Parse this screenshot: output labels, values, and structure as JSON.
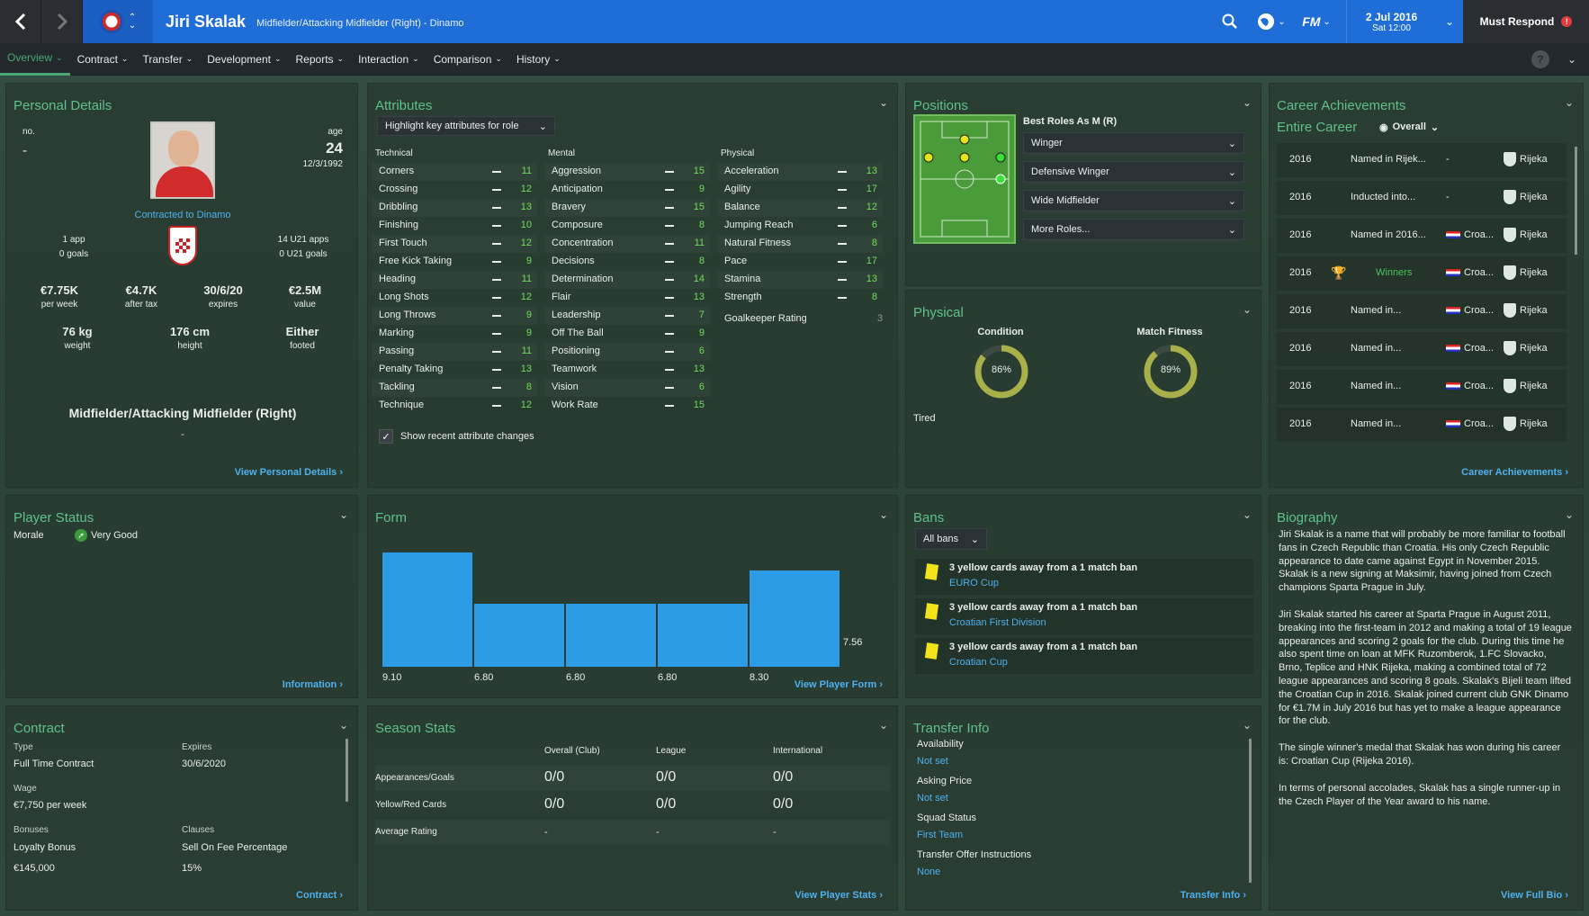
{
  "header": {
    "player_name": "Jiri Skalak",
    "player_subtitle": "Midfielder/Attacking Midfielder (Right) - Dinamo",
    "date": "2 Jul 2016",
    "time": "Sat 12:00",
    "must_respond": "Must Respond",
    "notif_count": "!",
    "fm_logo": "FM"
  },
  "tabs": [
    {
      "label": "Overview"
    },
    {
      "label": "Contract"
    },
    {
      "label": "Transfer"
    },
    {
      "label": "Development"
    },
    {
      "label": "Reports"
    },
    {
      "label": "Interaction"
    },
    {
      "label": "Comparison"
    },
    {
      "label": "History"
    }
  ],
  "help_label": "?",
  "personal": {
    "title": "Personal Details",
    "no_label": "no.",
    "no_value": "-",
    "age_label": "age",
    "age_value": "24",
    "dob": "12/3/1992",
    "contracted": "Contracted to Dinamo",
    "apps": "1 app",
    "goals": "0 goals",
    "u21_apps": "14 U21 apps",
    "u21_goals": "0 U21 goals",
    "stats": [
      {
        "value": "€7.75K",
        "label": "per week"
      },
      {
        "value": "€4.7K",
        "label": "after tax"
      },
      {
        "value": "30/6/20",
        "label": "expires"
      },
      {
        "value": "€2.5M",
        "label": "value"
      }
    ],
    "body": [
      {
        "value": "76 kg",
        "label": "weight"
      },
      {
        "value": "176 cm",
        "label": "height"
      },
      {
        "value": "Either",
        "label": "footed"
      }
    ],
    "position": "Midfielder/Attacking Midfielder (Right)",
    "dash": "-",
    "link": "View Personal Details"
  },
  "attributes": {
    "title": "Attributes",
    "highlight": "Highlight key attributes for role",
    "headers": [
      "Technical",
      "Mental",
      "Physical"
    ],
    "technical": [
      [
        "Corners",
        "11"
      ],
      [
        "Crossing",
        "12"
      ],
      [
        "Dribbling",
        "13"
      ],
      [
        "Finishing",
        "10"
      ],
      [
        "First Touch",
        "12"
      ],
      [
        "Free Kick Taking",
        "9"
      ],
      [
        "Heading",
        "11"
      ],
      [
        "Long Shots",
        "12"
      ],
      [
        "Long Throws",
        "9"
      ],
      [
        "Marking",
        "9"
      ],
      [
        "Passing",
        "11"
      ],
      [
        "Penalty Taking",
        "13"
      ],
      [
        "Tackling",
        "8"
      ],
      [
        "Technique",
        "12"
      ]
    ],
    "mental": [
      [
        "Aggression",
        "15"
      ],
      [
        "Anticipation",
        "9"
      ],
      [
        "Bravery",
        "15"
      ],
      [
        "Composure",
        "8"
      ],
      [
        "Concentration",
        "11"
      ],
      [
        "Decisions",
        "8"
      ],
      [
        "Determination",
        "14"
      ],
      [
        "Flair",
        "13"
      ],
      [
        "Leadership",
        "7"
      ],
      [
        "Off The Ball",
        "9"
      ],
      [
        "Positioning",
        "6"
      ],
      [
        "Teamwork",
        "13"
      ],
      [
        "Vision",
        "6"
      ],
      [
        "Work Rate",
        "15"
      ]
    ],
    "physical": [
      [
        "Acceleration",
        "13"
      ],
      [
        "Agility",
        "17"
      ],
      [
        "Balance",
        "12"
      ],
      [
        "Jumping Reach",
        "6"
      ],
      [
        "Natural Fitness",
        "8"
      ],
      [
        "Pace",
        "17"
      ],
      [
        "Stamina",
        "13"
      ],
      [
        "Strength",
        "8"
      ]
    ],
    "gk_label": "Goalkeeper Rating",
    "gk_value": "3",
    "show_changes": "Show recent attribute changes"
  },
  "positions": {
    "title": "Positions",
    "best_roles": "Best Roles As M (R)",
    "roles": [
      "Winger",
      "Defensive Winger",
      "Wide Midfielder",
      "More Roles..."
    ]
  },
  "physical": {
    "title": "Physical",
    "condition_label": "Condition",
    "condition_value": "86%",
    "condition_pct": 86,
    "fitness_label": "Match Fitness",
    "fitness_value": "89%",
    "fitness_pct": 89,
    "status": "Tired"
  },
  "career": {
    "title": "Career Achievements",
    "scope": "Entire Career",
    "filter": "Overall",
    "rows": [
      {
        "year": "2016",
        "desc": "Named in Rijek...",
        "flag": "-",
        "club": "Rijeka",
        "winner": false
      },
      {
        "year": "2016",
        "desc": "Inducted into...",
        "flag": "-",
        "club": "Rijeka",
        "winner": false
      },
      {
        "year": "2016",
        "desc": "Named in 2016...",
        "flag": "Croa...",
        "club": "Rijeka",
        "winner": false
      },
      {
        "year": "2016",
        "desc": "Winners",
        "flag": "Croa...",
        "club": "Rijeka",
        "winner": true
      },
      {
        "year": "2016",
        "desc": "Named in...",
        "flag": "Croa...",
        "club": "Rijeka",
        "winner": false
      },
      {
        "year": "2016",
        "desc": "Named in...",
        "flag": "Croa...",
        "club": "Rijeka",
        "winner": false
      },
      {
        "year": "2016",
        "desc": "Named in...",
        "flag": "Croa...",
        "club": "Rijeka",
        "winner": false
      },
      {
        "year": "2016",
        "desc": "Named in...",
        "flag": "Croa...",
        "club": "Rijeka",
        "winner": false
      }
    ],
    "link": "Career Achievements"
  },
  "status": {
    "title": "Player Status",
    "morale_label": "Morale",
    "morale_value": "Very Good",
    "link": "Information"
  },
  "form": {
    "title": "Form",
    "ratings": [
      9.1,
      6.8,
      6.8,
      6.8,
      8.3
    ],
    "labels": [
      "9.10",
      "6.80",
      "6.80",
      "6.80",
      "8.30"
    ],
    "average": "7.56",
    "link": "View Player Form"
  },
  "bans": {
    "title": "Bans",
    "filter": "All bans",
    "items": [
      {
        "text": "3 yellow cards away from a 1 match ban",
        "comp": "EURO Cup"
      },
      {
        "text": "3 yellow cards away from a 1 match ban",
        "comp": "Croatian First Division"
      },
      {
        "text": "3 yellow cards away from a 1 match ban",
        "comp": "Croatian Cup"
      }
    ]
  },
  "biography": {
    "title": "Biography",
    "paragraphs": [
      "Jiri Skalak is a name that will probably be more familiar to football fans in Czech Republic than Croatia. His only Czech Republic appearance to date came against Egypt in November 2015. Skalak is a new signing at Maksimir, having joined from Czech champions Sparta Prague in July.",
      "Jiri Skalak started his career at Sparta Prague in August 2011, breaking into the first-team in 2012 and making a total of 19 league appearances and scoring 2 goals for the club. During this time he also spent time on loan at MFK Ruzomberok, 1.FC Slovacko, Brno, Teplice and HNK Rijeka, making a combined total of 72 league appearances and scoring 8 goals. Skalak's Bijeli team lifted the Croatian Cup in 2016. Skalak joined current club GNK Dinamo for €1.7M in July 2016 but has yet to make a league appearance for the club.",
      "The single winner's medal that Skalak has won during his career is: Croatian Cup (Rijeka 2016).",
      "In terms of personal accolades, Skalak has a single runner-up in the Czech Player of the Year award to his name."
    ],
    "link": "View Full Bio"
  },
  "contract": {
    "title": "Contract",
    "type_label": "Type",
    "type_value": "Full Time Contract",
    "expires_label": "Expires",
    "expires_value": "30/6/2020",
    "wage_label": "Wage",
    "wage_value": "€7,750 per week",
    "bonuses_label": "Bonuses",
    "clauses_label": "Clauses",
    "bonus_name": "Loyalty Bonus",
    "bonus_value": "€145,000",
    "clause_name": "Sell On Fee Percentage",
    "clause_value": "15%",
    "link": "Contract"
  },
  "season": {
    "title": "Season Stats",
    "cols": [
      "Overall (Club)",
      "League",
      "International"
    ],
    "rows": [
      {
        "label": "Appearances/Goals",
        "vals": [
          "0/0",
          "0/0",
          "0/0"
        ]
      },
      {
        "label": "Yellow/Red Cards",
        "vals": [
          "0/0",
          "0/0",
          "0/0"
        ]
      },
      {
        "label": "Average Rating",
        "vals": [
          "-",
          "-",
          "-"
        ]
      }
    ],
    "link": "View Player Stats"
  },
  "transfer": {
    "title": "Transfer Info",
    "items": [
      {
        "label": "Availability",
        "value": "Not set"
      },
      {
        "label": "Asking Price",
        "value": "Not set"
      },
      {
        "label": "Squad Status",
        "value": "First Team"
      },
      {
        "label": "Transfer Offer Instructions",
        "value": "None"
      }
    ],
    "link": "Transfer Info"
  },
  "colors": {
    "accent": "#5ec08a",
    "link": "#4fb0ee",
    "topbar": "#1f6dd6",
    "form_bar": "#2e9be6",
    "attr_green": "#6de05a"
  }
}
